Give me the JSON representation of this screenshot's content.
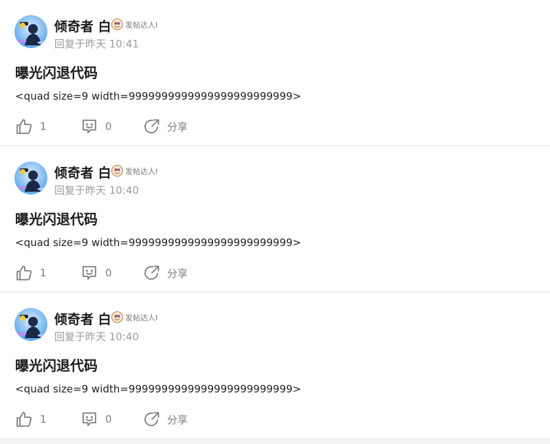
{
  "posts": [
    {
      "author": "倾奇者 白",
      "badge_label": "发帖达人I",
      "reply_time": "回复于昨天 10:41",
      "title": "曝光闪退代码",
      "body": "<quad size=9  width=9999999999999999999999999>",
      "likes": "1",
      "comments": "0",
      "share_label": "分享"
    },
    {
      "author": "倾奇者 白",
      "badge_label": "发帖达人I",
      "reply_time": "回复于昨天 10:40",
      "title": "曝光闪退代码",
      "body": "<quad size=9  width=9999999999999999999999999>",
      "likes": "1",
      "comments": "0",
      "share_label": "分享"
    },
    {
      "author": "倾奇者 白",
      "badge_label": "发帖达人I",
      "reply_time": "回复于昨天 10:40",
      "title": "曝光闪退代码",
      "body": "<quad size=9  width=9999999999999999999999999>",
      "likes": "1",
      "comments": "0",
      "share_label": "分享"
    }
  ],
  "icons": {
    "avatar": "avatar-image",
    "badge": "badge-icon",
    "like": "thumbs-up-icon",
    "comment": "comment-icon",
    "share": "share-icon"
  },
  "colors": {
    "page_bg": "#f2f2f4",
    "card_bg": "#ffffff",
    "primary_text": "#1a1a1a",
    "secondary_text": "#9b9ba0",
    "action_gray": "#7d7d82"
  }
}
